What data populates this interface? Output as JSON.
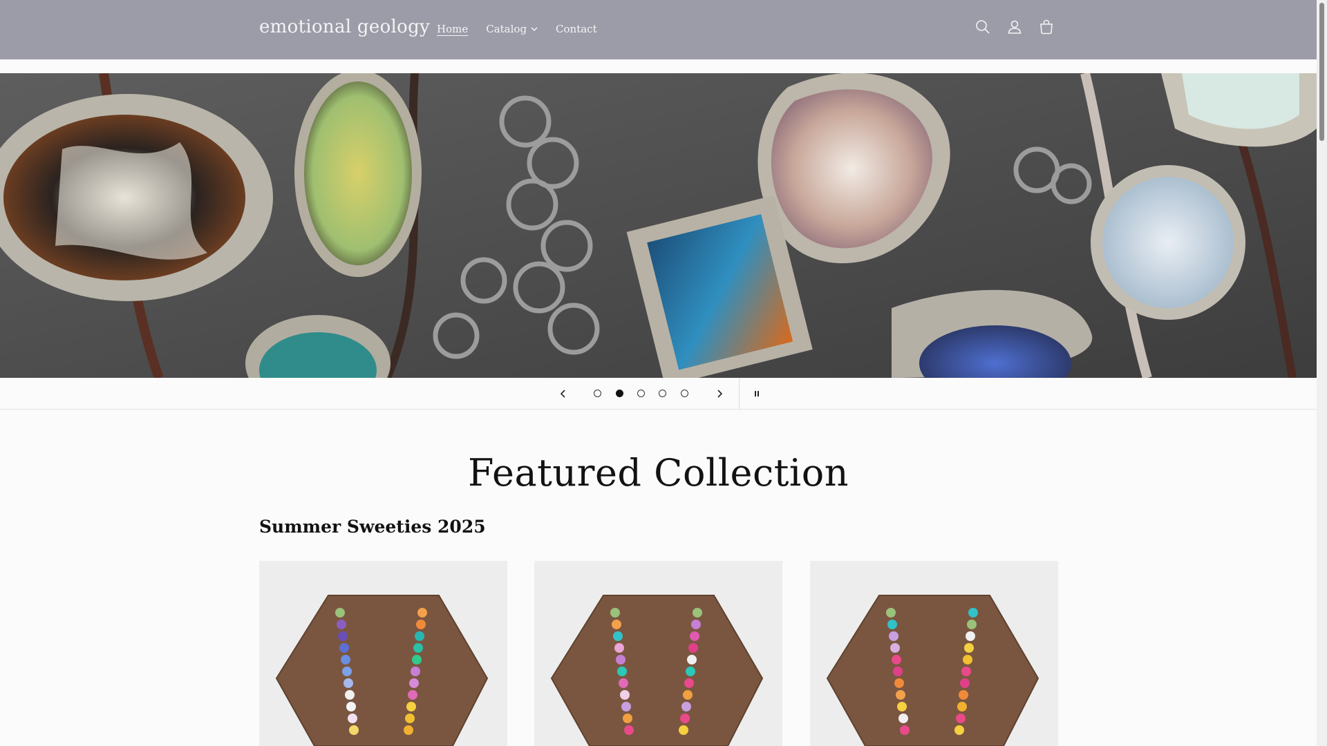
{
  "header": {
    "logo": "emotional geology",
    "nav": [
      {
        "label": "Home",
        "active": true
      },
      {
        "label": "Catalog",
        "has_dropdown": true
      },
      {
        "label": "Contact"
      }
    ],
    "icons": [
      "search-icon",
      "account-icon",
      "cart-icon"
    ],
    "background_color": "#9c9ca8"
  },
  "hero": {
    "slide_count": 5,
    "active_slide": 2,
    "controls": [
      "previous-slide",
      "next-slide",
      "pause-slideshow"
    ]
  },
  "featured": {
    "title": "Featured Collection",
    "collection_name": "Summer Sweeties 2025",
    "products": [
      {
        "image": "rainbow bead necklace on walnut display"
      },
      {
        "image": "rainbow bead necklace on walnut display"
      },
      {
        "image": "rainbow bead necklace on walnut display"
      }
    ]
  }
}
